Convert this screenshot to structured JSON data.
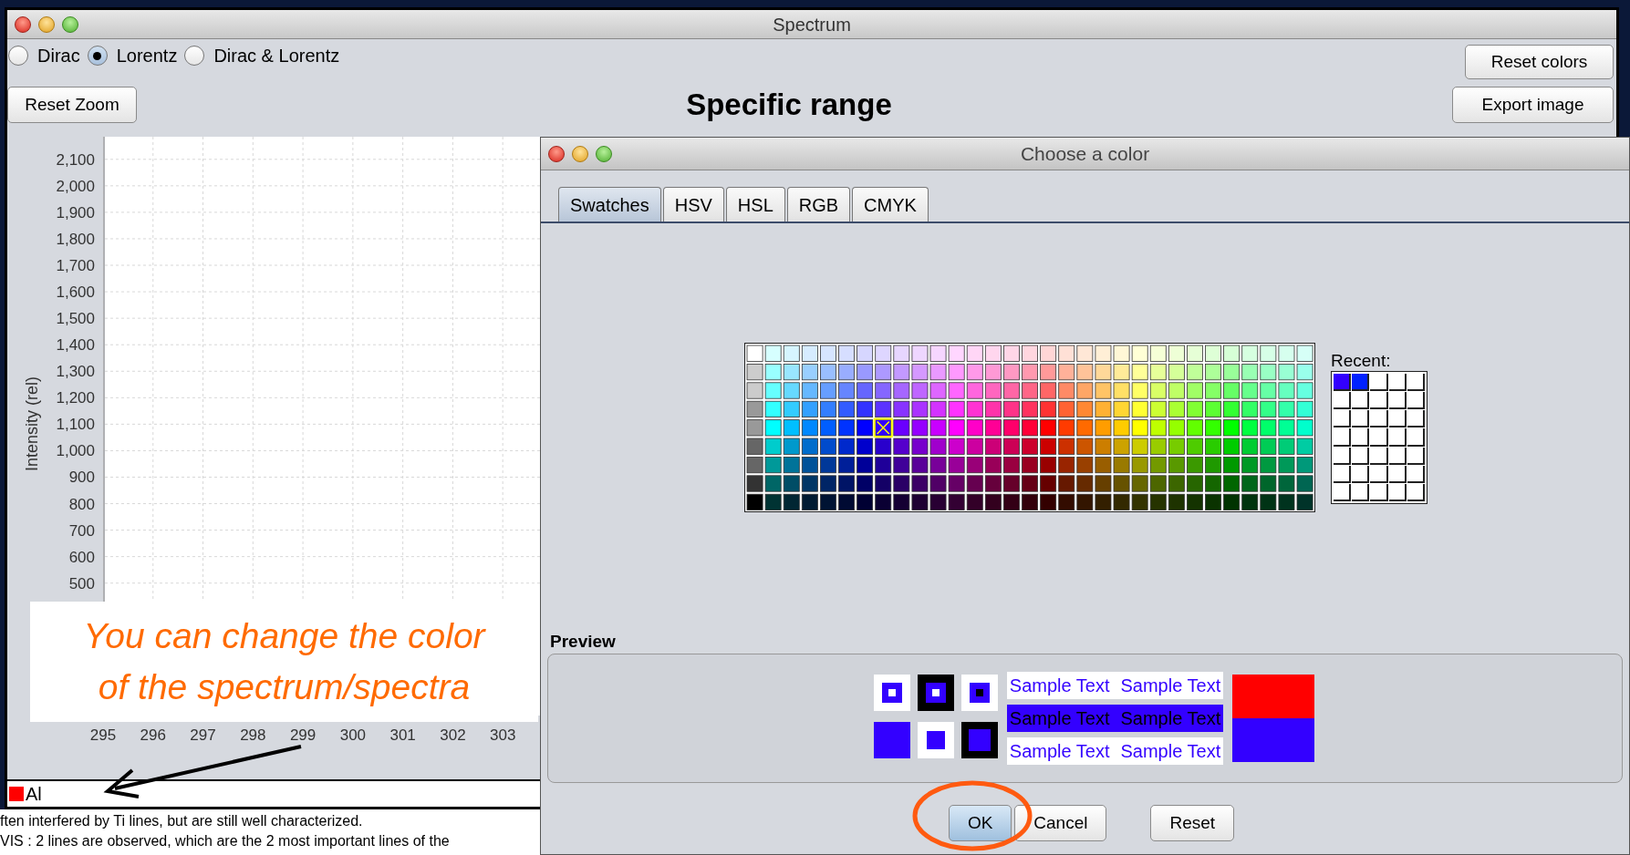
{
  "window": {
    "title": "Spectrum"
  },
  "profiles": [
    {
      "label": "Dirac",
      "selected": false
    },
    {
      "label": "Lorentz",
      "selected": true
    },
    {
      "label": "Dirac & Lorentz",
      "selected": false
    }
  ],
  "buttons": {
    "reset_zoom": "Reset Zoom",
    "reset_colors": "Reset colors",
    "export_image": "Export image"
  },
  "chart_title": "Specific range",
  "chart": {
    "chart_data": {
      "type": "line",
      "grid": true,
      "ylabel": "Intensity (rel)",
      "xlim": [
        295,
        303.8
      ],
      "ylim": [
        0,
        2175
      ],
      "xticks": [
        295,
        296,
        297,
        298,
        299,
        300,
        301,
        302,
        303
      ],
      "yticks": [
        {
          "value": 2100,
          "label": "2,100"
        },
        {
          "value": 2000,
          "label": "2,000"
        },
        {
          "value": 1900,
          "label": "1,900"
        },
        {
          "value": 1800,
          "label": "1,800"
        },
        {
          "value": 1700,
          "label": "1,700"
        },
        {
          "value": 1600,
          "label": "1,600"
        },
        {
          "value": 1500,
          "label": "1,500"
        },
        {
          "value": 1400,
          "label": "1,400"
        },
        {
          "value": 1300,
          "label": "1,300"
        },
        {
          "value": 1200,
          "label": "1,200"
        },
        {
          "value": 1100,
          "label": "1,100"
        },
        {
          "value": 1000,
          "label": "1,000"
        },
        {
          "value": 900,
          "label": "900"
        },
        {
          "value": 800,
          "label": "800"
        },
        {
          "value": 700,
          "label": "700"
        },
        {
          "value": 600,
          "label": "600"
        },
        {
          "value": 500,
          "label": "500"
        }
      ]
    }
  },
  "legend": [
    {
      "label": "Al",
      "color": "#ff0000"
    }
  ],
  "annotation": {
    "text": "You can change the color of the spectrum/spectra"
  },
  "background_text": [
    "ften interfered by Ti lines, but are still well characterized.",
    "VIS : 2 lines are observed, which are the 2 most important lines of the"
  ],
  "dialog": {
    "title": "Choose a color",
    "tabs": [
      {
        "label": "Swatches",
        "selected": true
      },
      {
        "label": "HSV",
        "selected": false
      },
      {
        "label": "HSL",
        "selected": false
      },
      {
        "label": "RGB",
        "selected": false
      },
      {
        "label": "CMYK",
        "selected": false
      }
    ],
    "recent_label": "Recent:",
    "recent": [
      {
        "color": "#3300ff"
      },
      {
        "color": "#0022ff"
      }
    ],
    "preview_label": "Preview",
    "preview_swatches": [
      {
        "kind": "old",
        "color": "#ff0000"
      },
      {
        "kind": "new",
        "color": "#3300ff"
      }
    ],
    "sample_rows": [
      {
        "kind": "plain",
        "texts": [
          "Sample Text",
          "Sample Text"
        ]
      },
      {
        "kind": "filled",
        "texts": [
          "Sample Text",
          "Sample Text"
        ]
      },
      {
        "kind": "plain",
        "texts": [
          "Sample Text",
          "Sample Text"
        ]
      }
    ],
    "buttons": [
      {
        "label": "OK",
        "default": true
      },
      {
        "label": "Cancel",
        "default": false
      },
      {
        "label": "Reset",
        "default": false
      }
    ]
  }
}
